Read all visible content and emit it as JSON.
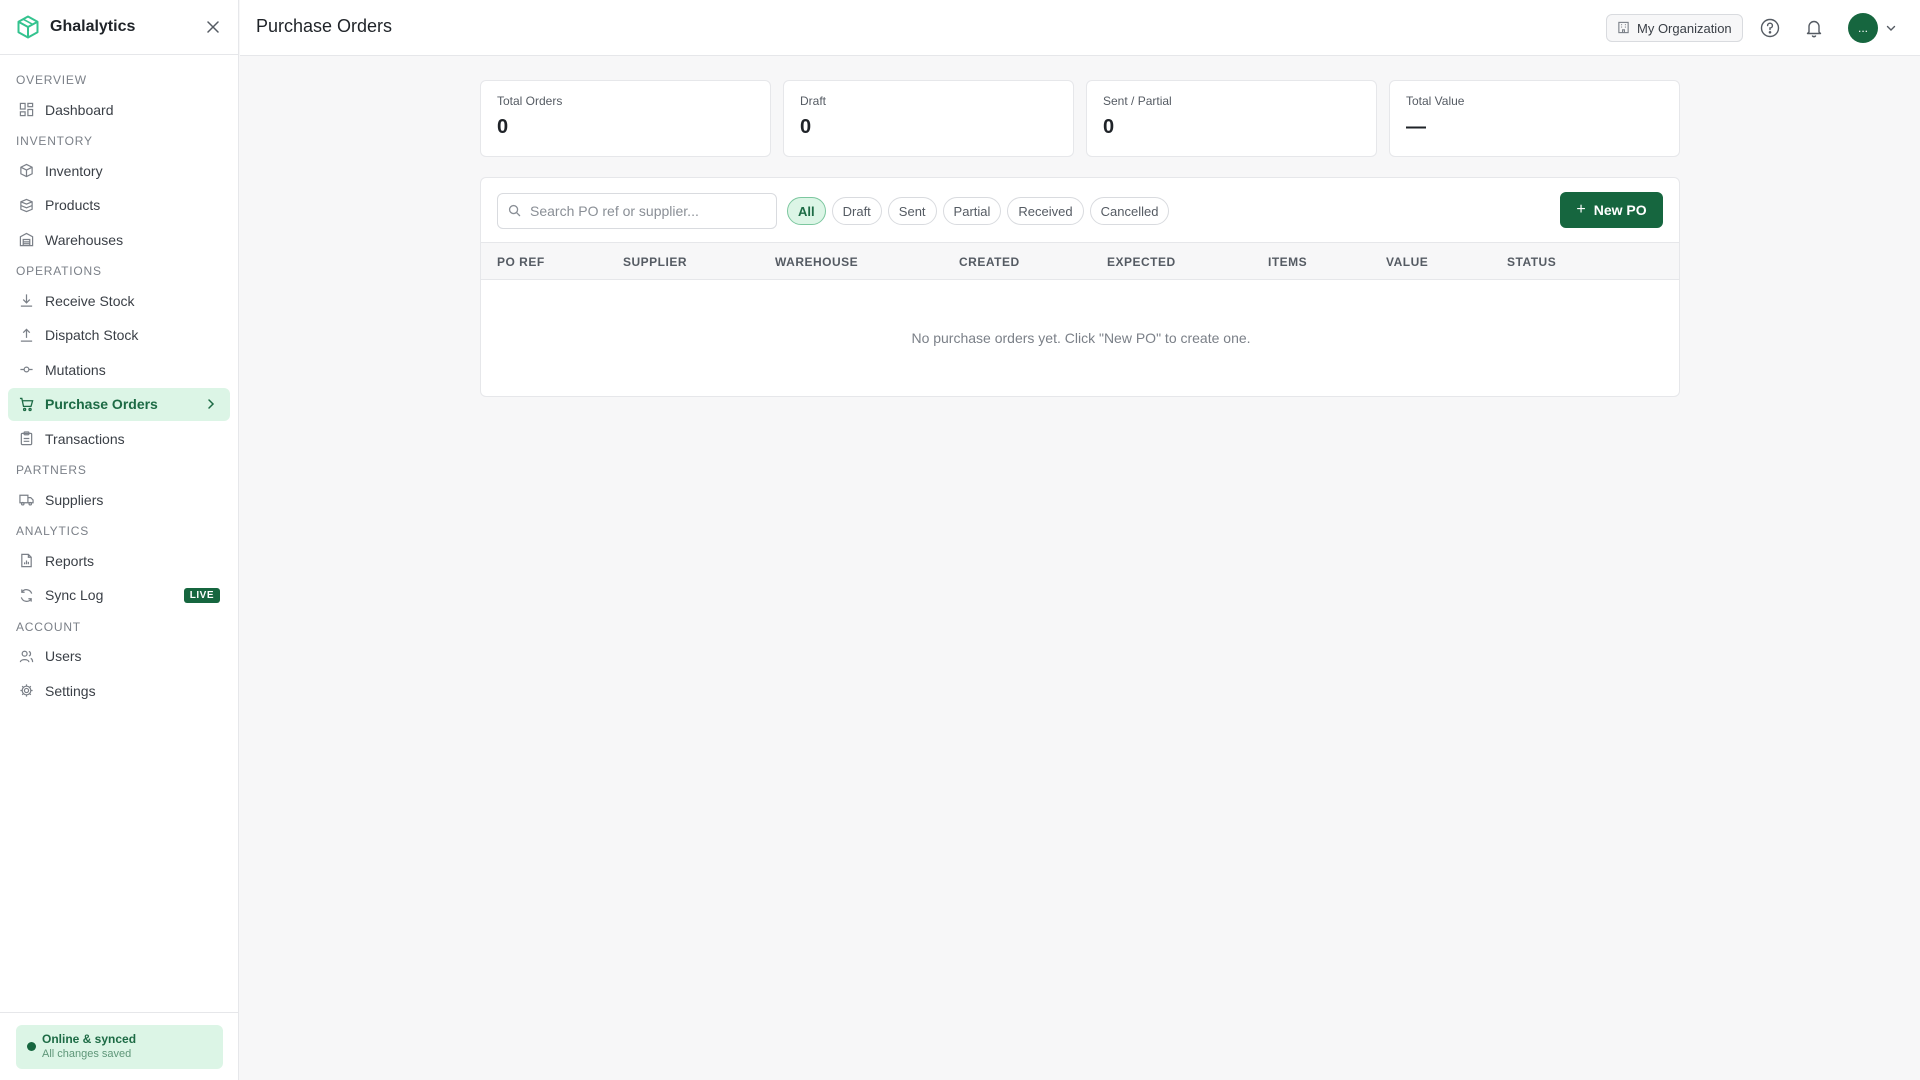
{
  "app": {
    "name": "Ghalalytics"
  },
  "sidebar": {
    "sections": {
      "overview": "OVERVIEW",
      "inventory": "INVENTORY",
      "operations": "OPERATIONS",
      "partners": "PARTNERS",
      "analytics": "ANALYTICS",
      "account": "ACCOUNT"
    },
    "items": {
      "dashboard": "Dashboard",
      "inventory": "Inventory",
      "products": "Products",
      "warehouses": "Warehouses",
      "receive_stock": "Receive Stock",
      "dispatch_stock": "Dispatch Stock",
      "mutations": "Mutations",
      "purchase_orders": "Purchase Orders",
      "transactions": "Transactions",
      "suppliers": "Suppliers",
      "reports": "Reports",
      "sync_log": "Sync Log",
      "users": "Users",
      "settings": "Settings"
    },
    "live_badge": "LIVE",
    "footer": {
      "title": "Online & synced",
      "subtitle": "All changes saved"
    }
  },
  "topbar": {
    "title": "Purchase Orders",
    "organization": "My Organization",
    "avatar_text": "..."
  },
  "stats": [
    {
      "label": "Total Orders",
      "value": "0"
    },
    {
      "label": "Draft",
      "value": "0"
    },
    {
      "label": "Sent / Partial",
      "value": "0"
    },
    {
      "label": "Total Value",
      "value": "—"
    }
  ],
  "toolbar": {
    "search_placeholder": "Search PO ref or supplier...",
    "filters": [
      "All",
      "Draft",
      "Sent",
      "Partial",
      "Received",
      "Cancelled"
    ],
    "active_filter": "All",
    "new_button": "New PO"
  },
  "table": {
    "columns": [
      "PO REF",
      "SUPPLIER",
      "WAREHOUSE",
      "CREATED",
      "EXPECTED",
      "ITEMS",
      "VALUE",
      "STATUS"
    ],
    "empty_message": "No purchase orders yet. Click \"New PO\" to create one."
  },
  "colors": {
    "brand": "#16663f",
    "active_bg": "#dcf5e6",
    "logo": "#34c38f"
  }
}
